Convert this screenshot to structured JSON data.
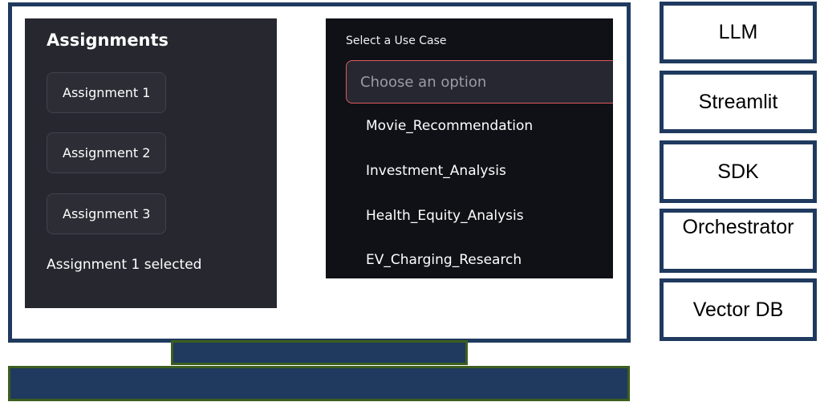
{
  "assignments": {
    "title": "Assignments",
    "buttons": [
      "Assignment 1",
      "Assignment 2",
      "Assignment 3"
    ],
    "status": "Assignment 1 selected"
  },
  "use_case": {
    "label": "Select a Use Case",
    "placeholder": "Choose an option",
    "options": [
      "Movie_Recommendation",
      "Investment_Analysis",
      "Health_Equity_Analysis",
      "EV_Charging_Research"
    ]
  },
  "stack": [
    "LLM",
    "Streamlit",
    "SDK",
    "Orchestrator",
    "Vector DB"
  ],
  "colors": {
    "frame": "#1f3a5e",
    "stand_border": "#3d5e1e",
    "panel_dark": "#272730",
    "select_panel": "#0f1117",
    "select_border": "#e05b5b"
  }
}
